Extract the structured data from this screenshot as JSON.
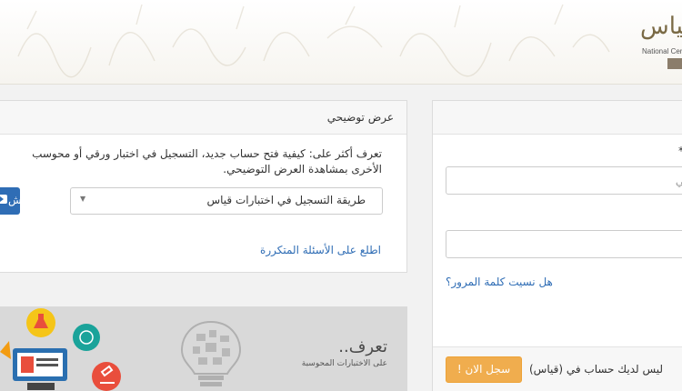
{
  "header": {
    "logo_arabic": "قياس",
    "logo_english": "National Cen"
  },
  "demo_panel": {
    "heading": "عرض توضيحي",
    "description_line1": "تعرف أكثر على: كيفية فتح حساب جديد، التسجيل في اختبار ورقي أو محوسب",
    "description_line2": "الأخرى بمشاهدة العرض التوضيحي.",
    "select_value": "طريقة التسجيل في اختبارات قياس",
    "watch_button": "تش",
    "faq_link": "اطلع على الأسئلة المتكررة"
  },
  "login_panel": {
    "required_mark": "*",
    "id_placeholder": "مدني",
    "forgot_password": "هل نسيت كلمة المرور؟",
    "no_account_text": "ليس لديك حساب في (قياس)",
    "register_button": "سجل الان !"
  },
  "banner": {
    "title": "تعرف..",
    "subtitle": "على الاختبارات المحوسبة"
  },
  "colors": {
    "link": "#2f6db5",
    "primary_button": "#2f6db5",
    "warning_button": "#f0ad4e",
    "banner_bg": "#d9d9d9"
  }
}
